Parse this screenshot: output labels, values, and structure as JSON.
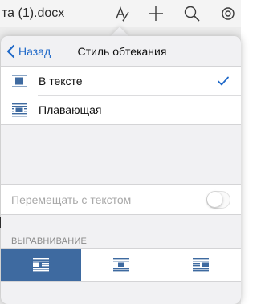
{
  "app": {
    "document_title": "та (1).docx",
    "toolbar_icons": [
      "format-text-icon",
      "plus-icon",
      "search-icon",
      "gear-icon"
    ]
  },
  "popover": {
    "nav": {
      "back_label": "Назад",
      "title": "Стиль обтекания"
    },
    "wrap_options": [
      {
        "label": "В тексте",
        "icon": "inline-wrap-icon",
        "selected": true
      },
      {
        "label": "Плавающая",
        "icon": "floating-wrap-icon",
        "selected": false
      }
    ],
    "move_with_text": {
      "label": "Перемещать с текстом",
      "enabled": false,
      "on": false
    },
    "alignment": {
      "header": "ВЫРАВНИВАНИЕ",
      "options": [
        "align-left-icon",
        "align-center-icon",
        "align-right-icon"
      ],
      "selected": 0
    }
  },
  "colors": {
    "accent": "#1e68c8",
    "selected_fill": "#3e6aa0",
    "icon_blue": "#3e6aa0"
  }
}
